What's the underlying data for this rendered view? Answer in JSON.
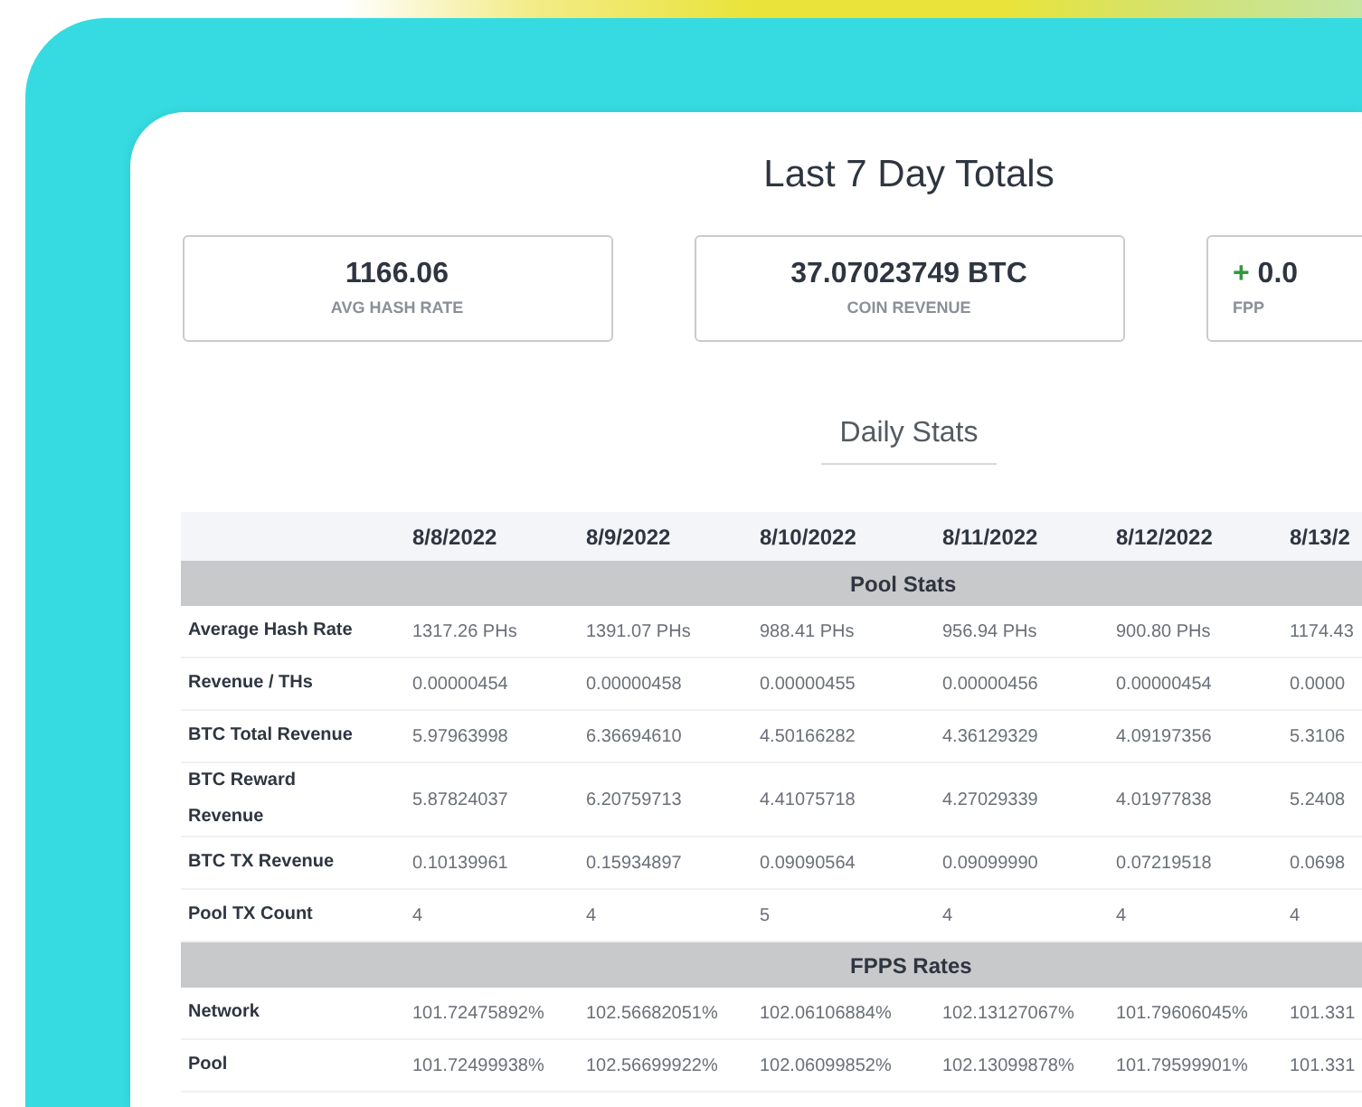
{
  "title": "Last 7 Day Totals",
  "totals": [
    {
      "value": "1166.06",
      "label": "AVG HASH RATE"
    },
    {
      "value": "37.07023749 BTC",
      "label": "COIN REVENUE"
    },
    {
      "sign": "+",
      "value": "0.0",
      "label": "FPP"
    }
  ],
  "daily_stats": {
    "title": "Daily Stats",
    "columns": [
      "8/8/2022",
      "8/9/2022",
      "8/10/2022",
      "8/11/2022",
      "8/12/2022",
      "8/13/2"
    ],
    "sections": [
      {
        "title": "Pool Stats",
        "rows": [
          {
            "label": "Average Hash Rate",
            "cells": [
              "1317.26 PHs",
              "1391.07 PHs",
              "988.41 PHs",
              "956.94 PHs",
              "900.80 PHs",
              "1174.43"
            ]
          },
          {
            "label": "Revenue / THs",
            "cells": [
              "0.00000454",
              "0.00000458",
              "0.00000455",
              "0.00000456",
              "0.00000454",
              "0.0000"
            ]
          },
          {
            "label": "BTC Total Revenue",
            "cells": [
              "5.97963998",
              "6.36694610",
              "4.50166282",
              "4.36129329",
              "4.09197356",
              "5.3106"
            ]
          },
          {
            "label": "BTC Reward Revenue",
            "cells": [
              "5.87824037",
              "6.20759713",
              "4.41075718",
              "4.27029339",
              "4.01977838",
              "5.2408"
            ]
          },
          {
            "label": "BTC TX Revenue",
            "cells": [
              "0.10139961",
              "0.15934897",
              "0.09090564",
              "0.09099990",
              "0.07219518",
              "0.0698"
            ]
          },
          {
            "label": "Pool TX Count",
            "cells": [
              "4",
              "4",
              "5",
              "4",
              "4",
              "4"
            ]
          }
        ]
      },
      {
        "title": "FPPS Rates",
        "rows": [
          {
            "label": "Network",
            "cells": [
              "101.72475892%",
              "102.56682051%",
              "102.06106884%",
              "102.13127067%",
              "101.79606045%",
              "101.331"
            ]
          },
          {
            "label": "Pool",
            "cells": [
              "101.72499938%",
              "102.56699922%",
              "102.06099852%",
              "102.13099878%",
              "101.79599901%",
              "101.331"
            ]
          }
        ]
      }
    ]
  }
}
